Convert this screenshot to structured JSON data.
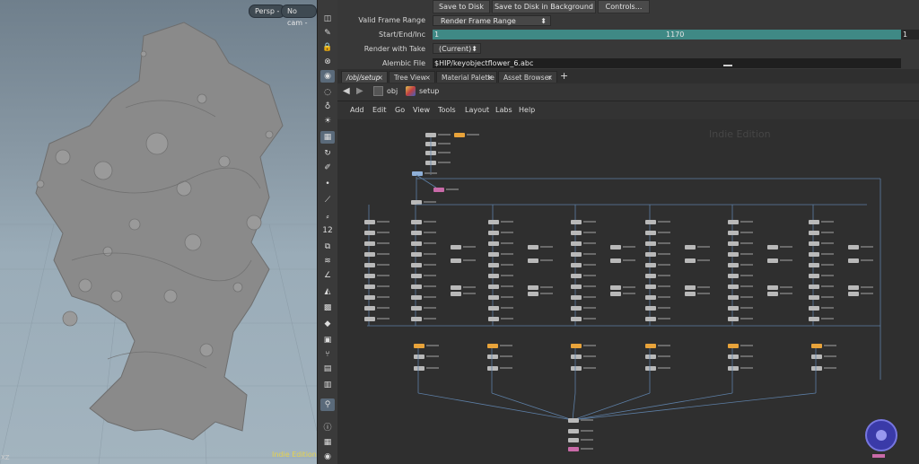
{
  "viewport": {
    "camera_persp": "Persp -",
    "camera_nocam": "No cam -",
    "watermark": "Indie Edition",
    "axis_label": "XZ"
  },
  "toolbar": {
    "icons": [
      "select-icon",
      "pose-icon",
      "lock-icon",
      "close-icon",
      "camera-icon",
      "light-icon",
      "lightbulb-icon",
      "hand-icon",
      "snap-icon",
      "transform-icon",
      "dot-icon",
      "brush-icon",
      "pen-icon",
      "number-icon",
      "paint-icon",
      "stack-icon",
      "angle-icon",
      "wave-icon",
      "grid-icon",
      "object-icon",
      "bird-icon",
      "branch-icon",
      "box-icon",
      "image-icon",
      "pin-icon",
      "info-icon",
      "layout-icon",
      "eye-icon"
    ],
    "number_label": "12"
  },
  "render": {
    "save_to_disk": "Save to Disk",
    "save_background": "Save to Disk in Background",
    "controls": "Controls...",
    "valid_frame_label": "Valid Frame Range",
    "valid_frame_value": "Render Frame Range",
    "start_end_label": "Start/End/Inc",
    "start": "1",
    "end": "1170",
    "inc": "1",
    "take_label": "Render with Take",
    "take_value": "(Current)",
    "alembic_label": "Alembic File",
    "alembic_value": "$HIP/keyobjectflower_6.abc"
  },
  "tabs": [
    {
      "label": "/obj/setup"
    },
    {
      "label": "Tree View"
    },
    {
      "label": "Material Palette"
    },
    {
      "label": "Asset Browser"
    }
  ],
  "path": {
    "obj": "obj",
    "setup": "setup"
  },
  "menu": [
    "Add",
    "Edit",
    "Go",
    "View",
    "Tools",
    "Layout",
    "Labs",
    "Help"
  ],
  "network": {
    "watermark": "Indie Edition",
    "accent_orange": "#e8a33a",
    "accent_teal": "#3e8e8a",
    "wire_color": "#5d7fa6",
    "node_color": "#b9b9b9",
    "dop_color": "#c96aa8"
  }
}
